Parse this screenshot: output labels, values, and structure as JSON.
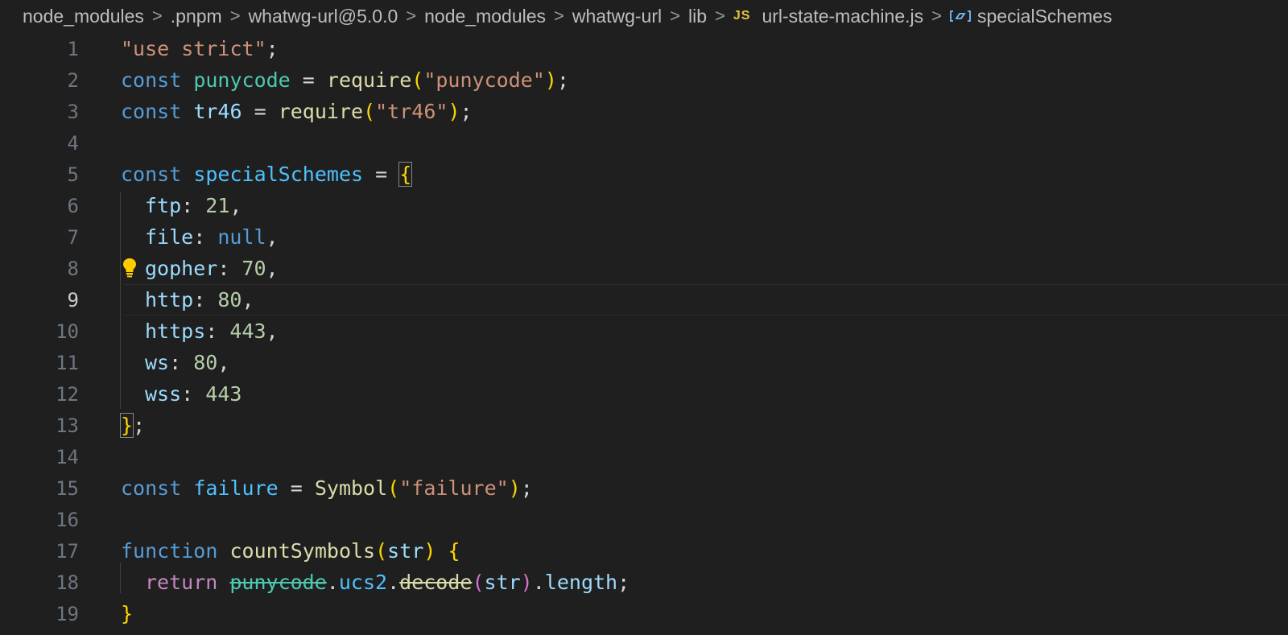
{
  "breadcrumb": {
    "items": [
      "node_modules",
      ".pnpm",
      "whatwg-url@5.0.0",
      "node_modules",
      "whatwg-url",
      "lib"
    ],
    "file": "url-state-machine.js",
    "file_icon": "JS",
    "symbol": "specialSchemes",
    "separator": ">"
  },
  "editor": {
    "current_line": 9,
    "line_numbers": [
      "1",
      "2",
      "3",
      "4",
      "5",
      "6",
      "7",
      "8",
      "9",
      "10",
      "11",
      "12",
      "13",
      "14",
      "15",
      "16",
      "17",
      "18",
      "19"
    ],
    "lines": {
      "l1": [
        "\"use strict\"",
        ";"
      ],
      "l2": [
        "const",
        " ",
        "punycode",
        " = ",
        "require",
        "(",
        "\"punycode\"",
        ")",
        ";"
      ],
      "l3": [
        "const",
        " ",
        "tr46",
        " = ",
        "require",
        "(",
        "\"tr46\"",
        ")",
        ";"
      ],
      "l5": [
        "const",
        " ",
        "specialSchemes",
        " = ",
        "{"
      ],
      "l6": [
        "ftp",
        ": ",
        "21",
        ","
      ],
      "l7": [
        "file",
        ": ",
        "null",
        ","
      ],
      "l8": [
        "gopher",
        ": ",
        "70",
        ","
      ],
      "l9": [
        "http",
        ": ",
        "80",
        ","
      ],
      "l10": [
        "https",
        ": ",
        "443",
        ","
      ],
      "l11": [
        "ws",
        ": ",
        "80",
        ","
      ],
      "l12": [
        "wss",
        ": ",
        "443"
      ],
      "l13": [
        "}",
        ";"
      ],
      "l15": [
        "const",
        " ",
        "failure",
        " = ",
        "Symbol",
        "(",
        "\"failure\"",
        ")",
        ";"
      ],
      "l17": [
        "function",
        " ",
        "countSymbols",
        "(",
        "str",
        ")",
        " ",
        "{"
      ],
      "l18": [
        "return",
        " ",
        "punycode",
        ".",
        "ucs2",
        ".",
        "decode",
        "(",
        "str",
        ")",
        ".",
        "length",
        ";"
      ],
      "l19": [
        "}"
      ]
    }
  },
  "colors": {
    "background": "#1f1f1f",
    "keyword": "#569cd6",
    "string": "#ce9178",
    "function": "#dcdcaa",
    "property": "#9cdcfe",
    "number": "#b5cea8",
    "bracket": "#ffd700"
  },
  "icons": [
    "chevron-right-icon",
    "js-file-icon",
    "symbol-variable-icon",
    "lightbulb-icon"
  ]
}
